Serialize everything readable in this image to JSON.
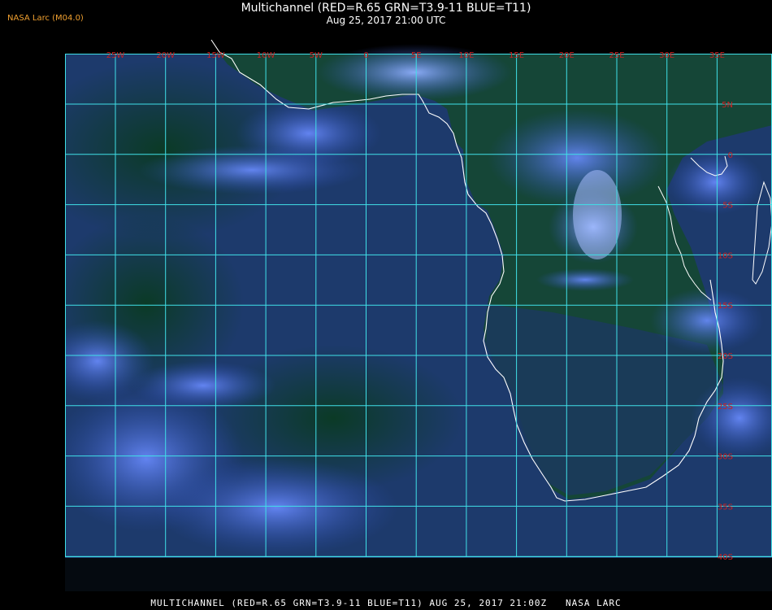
{
  "header": {
    "logo_text": "NASA Larc (M04.0)",
    "title": "Multichannel (RED=R.65 GRN=T3.9-11 BLUE=T11)",
    "subtitle": "Aug 25, 2017 21:00 UTC"
  },
  "footer": {
    "caption": "MULTICHANNEL (RED=R.65 GRN=T3.9-11 BLUE=T11) AUG 25, 2017 21:00Z   NASA LARC"
  },
  "map": {
    "longitude_labels": [
      "25W",
      "20W",
      "15W",
      "10W",
      "5W",
      "0",
      "5E",
      "10E",
      "15E",
      "20E",
      "25E",
      "30E",
      "35E"
    ],
    "latitude_labels": [
      "5N",
      "0",
      "5S",
      "10S",
      "15S",
      "20S",
      "25S",
      "30S",
      "35S",
      "40S"
    ],
    "colors": {
      "ocean": "#1a3c6a",
      "land": "#0e3a2a",
      "cloud": "#3a5fd0",
      "grid": "#40e0e8",
      "coast": "#ffffff",
      "label": "#cc2222"
    }
  }
}
